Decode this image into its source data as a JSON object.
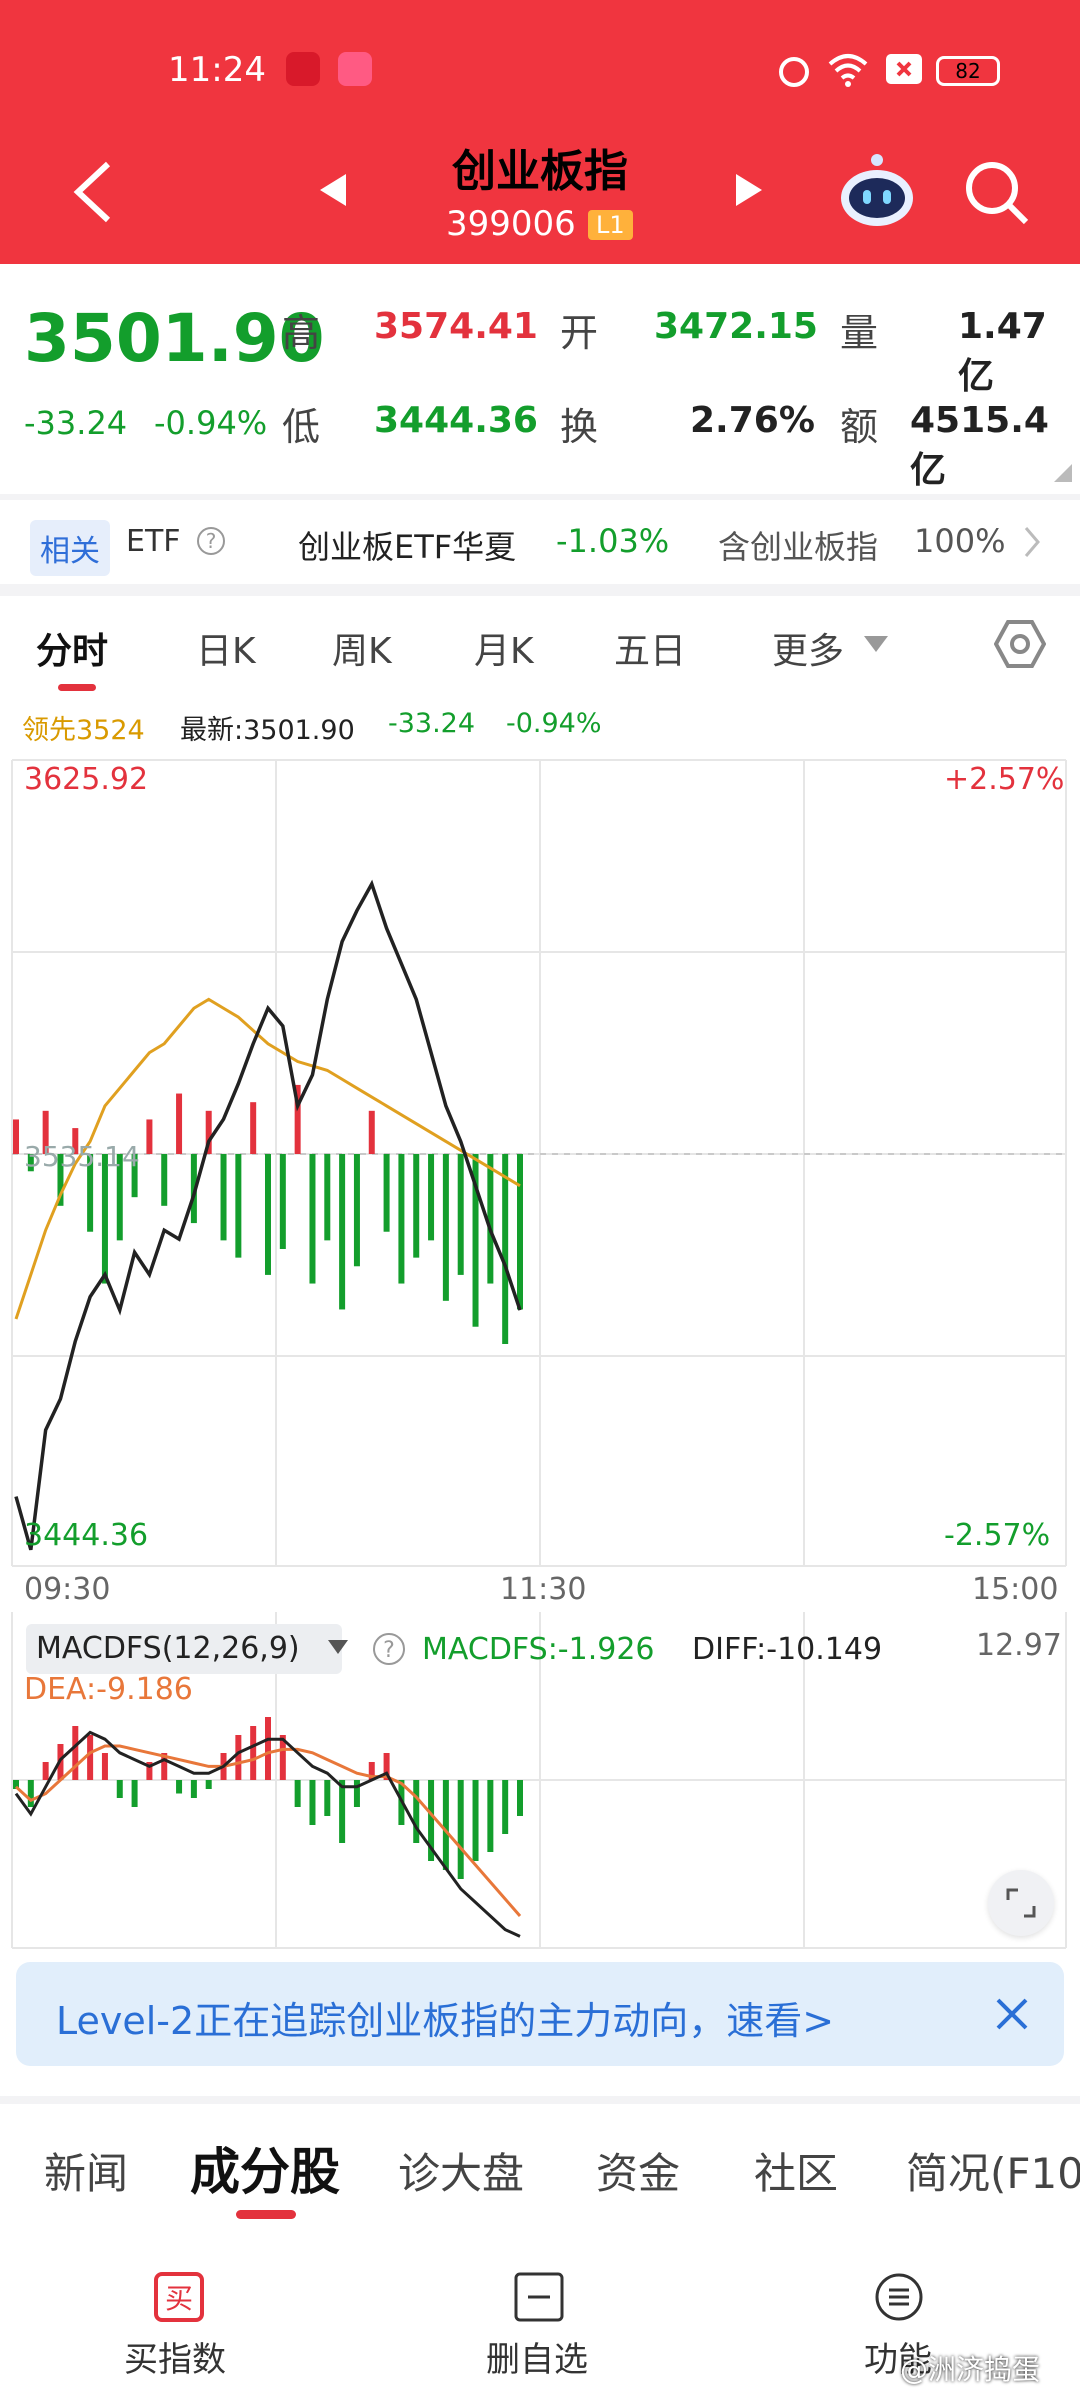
{
  "status": {
    "time": "11:24",
    "battery": "82"
  },
  "header": {
    "title": "创业板指",
    "code": "399006",
    "level": "L1"
  },
  "quote": {
    "price": "3501.90",
    "change": "-33.24",
    "change_pct": "-0.94%",
    "high_label": "高",
    "high": "3574.41",
    "open_label": "开",
    "open": "3472.15",
    "volume_label": "量",
    "volume": "1.47亿",
    "low_label": "低",
    "low": "3444.36",
    "turnover_label": "换",
    "turnover": "2.76%",
    "amount_label": "额",
    "amount": "4515.4亿"
  },
  "etf": {
    "tag": "相关",
    "type": "ETF",
    "name": "创业板ETF华夏",
    "change": "-1.03%",
    "holding": "含创业板指",
    "holding_pct": "100%"
  },
  "period_tabs": [
    "分时",
    "日K",
    "周K",
    "月K",
    "五日",
    "更多"
  ],
  "legend": {
    "lead": "领先3524",
    "latest": "最新:3501.90",
    "change": "-33.24",
    "pct": "-0.94%"
  },
  "chart_data": [
    {
      "type": "line",
      "y_max_label": "3625.92",
      "y_min_label": "3444.36",
      "pct_max_label": "+2.57%",
      "pct_min_label": "-2.57%",
      "ref_label": "3535.14",
      "x_labels": [
        "09:30",
        "11:30",
        "15:00"
      ],
      "ylim": [
        3444.36,
        3625.92
      ],
      "series": [
        {
          "values": [
            3460,
            3448,
            3475,
            3482,
            3495,
            3505,
            3510,
            3502,
            3515,
            3510,
            3520,
            3518,
            3528,
            3540,
            3545,
            3553,
            3562,
            3570,
            3566,
            3548,
            3555,
            3572,
            3585,
            3592,
            3598,
            3588,
            3580,
            3572,
            3560,
            3548,
            3540,
            3530,
            3520,
            3512,
            3502
          ]
        },
        {
          "values": [
            3500,
            3510,
            3520,
            3528,
            3535,
            3540,
            3548,
            3552,
            3556,
            3560,
            3562,
            3566,
            3570,
            3572,
            3570,
            3568,
            3565,
            3562,
            3560,
            3558,
            3557,
            3556,
            3554,
            3552,
            3550,
            3548,
            3546,
            3544,
            3542,
            3540,
            3538,
            3536,
            3534,
            3532,
            3530
          ]
        }
      ],
      "bars": [
        8,
        -4,
        10,
        -12,
        6,
        -18,
        -30,
        -20,
        -10,
        8,
        -12,
        14,
        -16,
        10,
        -20,
        -24,
        12,
        -28,
        -22,
        16,
        -30,
        -20,
        -36,
        -26,
        10,
        -18,
        -30,
        -24,
        -20,
        -34,
        -28,
        -40,
        -30,
        -44,
        -36
      ]
    },
    {
      "type": "bar",
      "indicator_label": "MACDFS(12,26,9)",
      "macdfs": "MACDFS:-1.926",
      "diff": "DIFF:-10.149",
      "dea": "DEA:-9.186",
      "max_label": "12.97",
      "values": [
        -2,
        -6,
        4,
        8,
        12,
        10,
        6,
        -4,
        -6,
        4,
        6,
        -3,
        -4,
        -2,
        6,
        10,
        12,
        14,
        10,
        -6,
        -10,
        -8,
        -14,
        -6,
        4,
        6,
        -10,
        -14,
        -18,
        -20,
        -22,
        -18,
        -16,
        -12,
        -8
      ],
      "series": [
        {
          "values": [
            -4,
            -10,
            -2,
            6,
            10,
            14,
            12,
            8,
            6,
            4,
            6,
            4,
            2,
            2,
            4,
            8,
            10,
            12,
            12,
            8,
            4,
            2,
            -2,
            -2,
            0,
            2,
            -6,
            -14,
            -20,
            -26,
            -32,
            -36,
            -40,
            -44,
            -46
          ]
        },
        {
          "values": [
            -2,
            -6,
            -4,
            0,
            4,
            8,
            10,
            10,
            9,
            8,
            7,
            6,
            5,
            4,
            4,
            5,
            6,
            8,
            9,
            9,
            8,
            6,
            4,
            2,
            1,
            1,
            -1,
            -5,
            -10,
            -15,
            -20,
            -25,
            -30,
            -35,
            -40
          ]
        }
      ]
    }
  ],
  "banner": "Level-2正在追踪创业板指的主力动向，速看>",
  "sub_tabs": [
    "新闻",
    "成分股",
    "诊大盘",
    "资金",
    "社区",
    "简况(F10"
  ],
  "nav": [
    {
      "label": "买指数"
    },
    {
      "label": "删自选"
    },
    {
      "label": "功能"
    }
  ],
  "watermark": "@洲济捣蛋",
  "colors": {
    "header": "#f0353f",
    "up": "#e3323d",
    "down": "#139e2c",
    "avg": "#e0a020"
  }
}
